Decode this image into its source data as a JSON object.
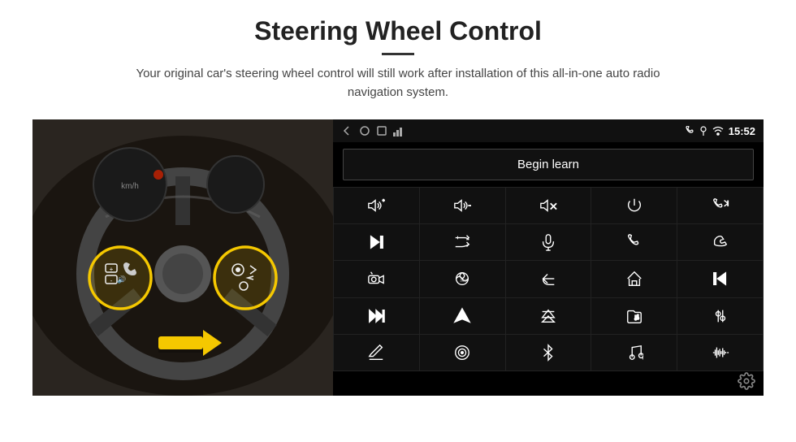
{
  "header": {
    "title": "Steering Wheel Control",
    "divider": true,
    "subtitle": "Your original car's steering wheel control will still work after installation of this all-in-one auto radio navigation system."
  },
  "android_panel": {
    "status_bar": {
      "time": "15:52",
      "icons": [
        "back-arrow",
        "home-circle",
        "square-recents",
        "signal-bars"
      ]
    },
    "begin_learn_button": "Begin learn",
    "icon_grid": [
      {
        "row": 1,
        "cells": [
          "volume-up-plus",
          "volume-down-minus",
          "volume-mute-x",
          "power",
          "phone-skip"
        ]
      },
      {
        "row": 2,
        "cells": [
          "skip-next",
          "shuffle-next",
          "microphone",
          "phone",
          "phone-end"
        ]
      },
      {
        "row": 3,
        "cells": [
          "camera-car",
          "camera-360",
          "back-arrow-curved",
          "home",
          "skip-back"
        ]
      },
      {
        "row": 4,
        "cells": [
          "skip-forward-fast",
          "navigation-arrow",
          "eject-swap",
          "folder-music",
          "equalizer"
        ]
      },
      {
        "row": 5,
        "cells": [
          "pencil",
          "circle-dot",
          "bluetooth",
          "music-note",
          "waveform"
        ]
      }
    ]
  },
  "settings": {
    "gear_label": "Settings"
  }
}
